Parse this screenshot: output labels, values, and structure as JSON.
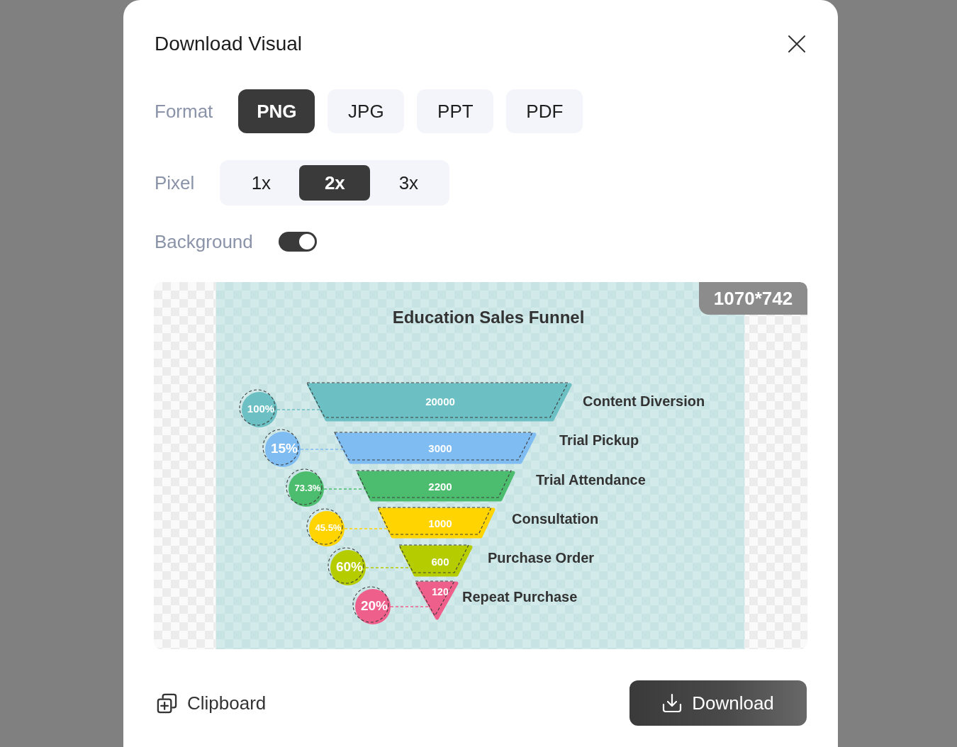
{
  "dialog": {
    "title": "Download Visual"
  },
  "format": {
    "label": "Format",
    "options": [
      {
        "label": "PNG",
        "selected": true
      },
      {
        "label": "JPG",
        "selected": false
      },
      {
        "label": "PPT",
        "selected": false
      },
      {
        "label": "PDF",
        "selected": false
      }
    ]
  },
  "pixel": {
    "label": "Pixel",
    "options": [
      {
        "label": "1x",
        "selected": false
      },
      {
        "label": "2x",
        "selected": true
      },
      {
        "label": "3x",
        "selected": false
      }
    ]
  },
  "background": {
    "label": "Background",
    "on": true
  },
  "preview": {
    "size": "1070*742",
    "title": "Education Sales Funnel",
    "stages": [
      {
        "value": "20000",
        "percent": "100%",
        "label": "Content Diversion",
        "color": "#6cc0c3"
      },
      {
        "value": "3000",
        "percent": "15%",
        "label": "Trial Pickup",
        "color": "#7fbcf2"
      },
      {
        "value": "2200",
        "percent": "73.3%",
        "label": "Trial Attendance",
        "color": "#4cbd6e"
      },
      {
        "value": "1000",
        "percent": "45.5%",
        "label": "Consultation",
        "color": "#ffd400"
      },
      {
        "value": "600",
        "percent": "60%",
        "label": "Purchase Order",
        "color": "#b5cc00"
      },
      {
        "value": "120",
        "percent": "20%",
        "label": "Repeat Purchase",
        "color": "#ef5f8c"
      }
    ]
  },
  "actions": {
    "clipboard": "Clipboard",
    "download": "Download"
  }
}
